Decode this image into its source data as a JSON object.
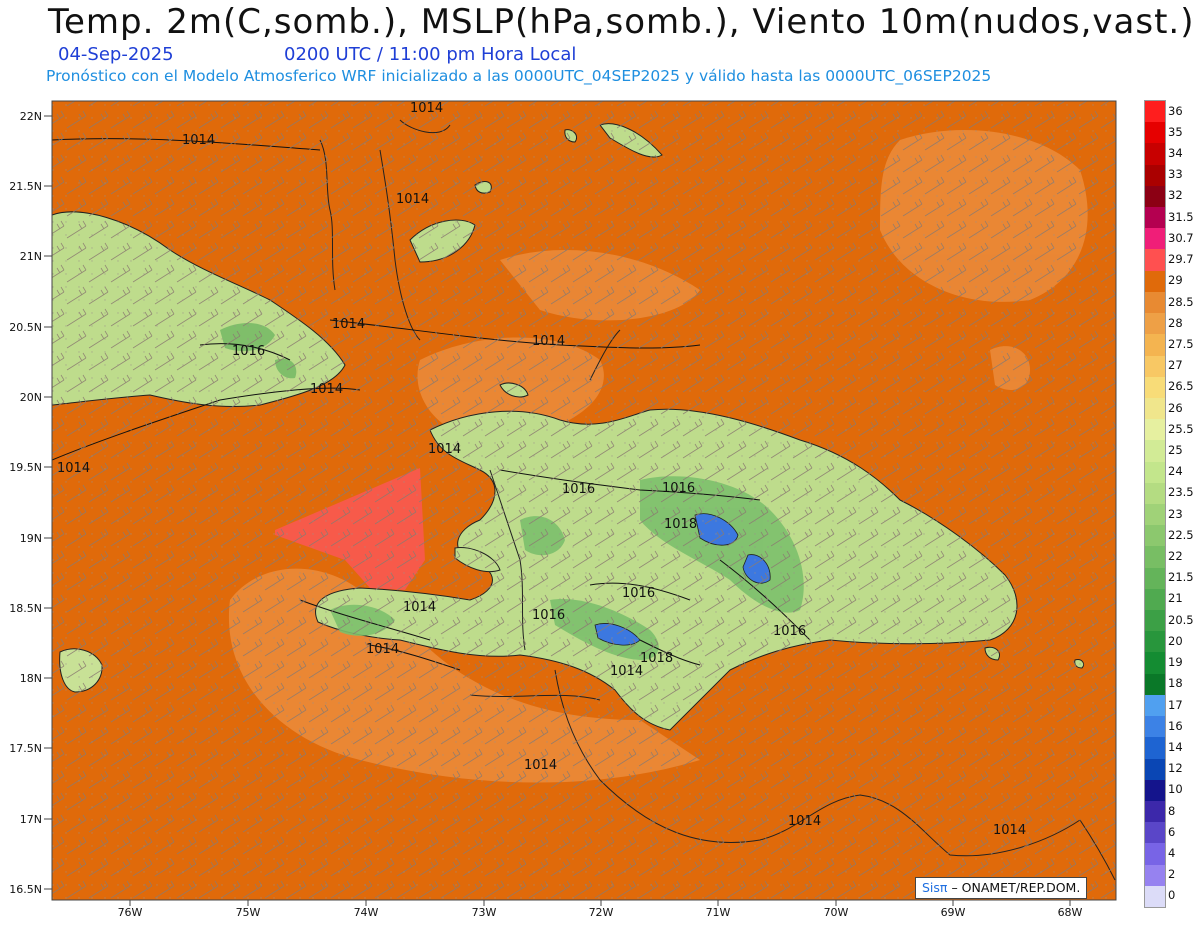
{
  "header": {
    "title": "Temp. 2m(C,somb.), MSLP(hPa,somb.), Viento 10m(nudos,vast.)",
    "date": "04-Sep-2025",
    "time": "0200 UTC / 11:00 pm Hora Local",
    "info": "Pronóstico con el Modelo Atmosferico WRF inicializado a las 0000UTC_04SEP2025 y válido hasta las  0000UTC_06SEP2025"
  },
  "map": {
    "lat_labels": [
      "22N",
      "21.5N",
      "21N",
      "20.5N",
      "20N",
      "19.5N",
      "19N",
      "18.5N",
      "18N",
      "17.5N",
      "17N",
      "16.5N"
    ],
    "lon_labels": [
      "76W",
      "75W",
      "74W",
      "73W",
      "72W",
      "71W",
      "70W",
      "69W",
      "68W"
    ],
    "isobar_labels": [
      "1014",
      "1014",
      "1014",
      "1014",
      "1014",
      "1014",
      "1014",
      "1014",
      "1014",
      "1014",
      "1016",
      "1016",
      "1016",
      "1016",
      "1016",
      "1016",
      "1018",
      "1018",
      "1014",
      "1014",
      "1014",
      "1014"
    ],
    "background_color": "#e06a0a"
  },
  "legend": {
    "labels": [
      "36",
      "35",
      "34",
      "33",
      "32",
      "31.5",
      "30.7",
      "29.7",
      "29",
      "28.5",
      "28",
      "27.5",
      "27",
      "26.5",
      "26",
      "25.5",
      "25",
      "24",
      "23.5",
      "23",
      "22.5",
      "22",
      "21.5",
      "21",
      "20.5",
      "20",
      "19",
      "18",
      "17",
      "16",
      "14",
      "12",
      "10",
      "8",
      "6",
      "4",
      "2",
      "0"
    ],
    "colors": [
      "#ff1e1e",
      "#e60000",
      "#c80000",
      "#aa0000",
      "#8c0014",
      "#b40050",
      "#f01e78",
      "#ff5050",
      "#e06a0a",
      "#e88a32",
      "#eea046",
      "#f4b450",
      "#f8c864",
      "#f8dc78",
      "#f0e68c",
      "#e6f0a0",
      "#d2eb96",
      "#c3e68c",
      "#b4dc82",
      "#a0d278",
      "#8cc86e",
      "#78be64",
      "#64b45a",
      "#50aa50",
      "#3ca046",
      "#28963c",
      "#148c32",
      "#0a7828",
      "#50a0f0",
      "#3c82e6",
      "#1e64d2",
      "#0a46b4",
      "#14148c",
      "#3c28aa",
      "#5a46c8",
      "#7864e6",
      "#9682f0",
      "#dcdcf8"
    ]
  },
  "credit": {
    "sis": "Sisπ",
    "text": "– ONAMET/REP.DOM."
  }
}
